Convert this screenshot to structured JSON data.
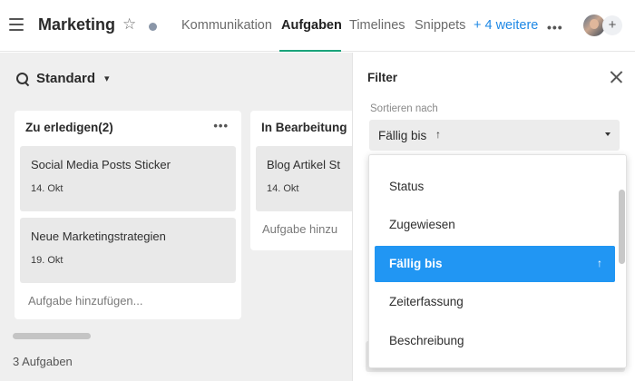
{
  "header": {
    "project_title": "Marketing",
    "star_icon": "★",
    "tabs": [
      {
        "label": "Kommunikation"
      },
      {
        "label": "Aufgaben"
      },
      {
        "label": "Timelines"
      },
      {
        "label": "Snippets"
      },
      {
        "label": "+ 4 weitere"
      }
    ],
    "active_tab": "Aufgaben",
    "more_menu": "•••",
    "add_member": "+"
  },
  "board": {
    "view_label": "Standard",
    "view_chevron": "⌄",
    "columns": [
      {
        "title": "Zu erledigen(2)",
        "menu": "•••",
        "cards": [
          {
            "title": "Social Media Posts Sticker",
            "date": "14. Okt"
          },
          {
            "title": "Neue Marketingstrategien",
            "date": "19. Okt"
          }
        ],
        "add_task": "Aufgabe hinzufügen..."
      },
      {
        "title": "In Bearbeitung",
        "cards": [
          {
            "title": "Blog Artikel St",
            "date": "14. Okt"
          }
        ],
        "add_task": "Aufgabe hinzu"
      }
    ],
    "task_count": "3 Aufgaben"
  },
  "filter": {
    "title": "Filter",
    "sort_label": "Sortieren nach",
    "sort_value": "Fällig bis",
    "sort_direction": "↑",
    "options": [
      {
        "label": "Status"
      },
      {
        "label": "Zugewiesen"
      },
      {
        "label": "Fällig bis",
        "arrow": "↑"
      },
      {
        "label": "Zeiterfassung"
      },
      {
        "label": "Beschreibung"
      }
    ],
    "selected_option": "Fällig bis"
  },
  "colors": {
    "accent_blue": "#2196f3",
    "tab_underline": "#1aa37a",
    "more_link": "#1e88e5",
    "board_bg": "#efefef"
  }
}
